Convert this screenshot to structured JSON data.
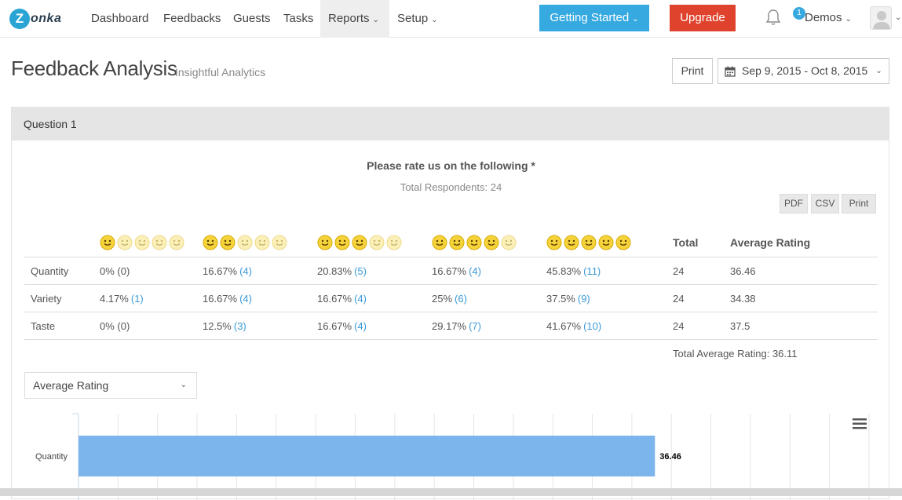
{
  "nav": {
    "logo_initial": "Z",
    "logo_rest": "onka",
    "items": [
      {
        "label": "Dashboard"
      },
      {
        "label": "Feedbacks"
      },
      {
        "label": "Guests"
      },
      {
        "label": "Tasks"
      },
      {
        "label": "Reports"
      },
      {
        "label": "Setup"
      }
    ],
    "getting_started": "Getting Started",
    "upgrade": "Upgrade",
    "notification_count": "1",
    "user": "Demos"
  },
  "page": {
    "title": "Feedback Analysis",
    "subtitle": "Insightful Analytics",
    "print": "Print",
    "date_range": "Sep 9, 2015 - Oct 8, 2015"
  },
  "panel": {
    "header": "Question 1",
    "question": "Please rate us on the following *",
    "respondents": "Total Respondents: 24",
    "export": [
      "PDF",
      "CSV",
      "Print"
    ]
  },
  "table": {
    "smiley_levels": [
      1,
      2,
      3,
      4,
      5
    ],
    "total_header": "Total",
    "avg_header": "Average Rating",
    "rows": [
      {
        "label": "Quantity",
        "cells": [
          {
            "pct": "0% (0)",
            "count": ""
          },
          {
            "pct": "16.67%",
            "count": "(4)"
          },
          {
            "pct": "20.83%",
            "count": "(5)"
          },
          {
            "pct": "16.67%",
            "count": "(4)"
          },
          {
            "pct": "45.83%",
            "count": "(11)"
          }
        ],
        "total": "24",
        "avg": "36.46"
      },
      {
        "label": "Variety",
        "cells": [
          {
            "pct": "4.17%",
            "count": "(1)"
          },
          {
            "pct": "16.67%",
            "count": "(4)"
          },
          {
            "pct": "16.67%",
            "count": "(4)"
          },
          {
            "pct": "25%",
            "count": "(6)"
          },
          {
            "pct": "37.5%",
            "count": "(9)"
          }
        ],
        "total": "24",
        "avg": "34.38"
      },
      {
        "label": "Taste",
        "cells": [
          {
            "pct": "0% (0)",
            "count": ""
          },
          {
            "pct": "12.5%",
            "count": "(3)"
          },
          {
            "pct": "16.67%",
            "count": "(4)"
          },
          {
            "pct": "29.17%",
            "count": "(7)"
          },
          {
            "pct": "41.67%",
            "count": "(10)"
          }
        ],
        "total": "24",
        "avg": "37.5"
      }
    ],
    "total_average": "Total Average Rating: 36.11"
  },
  "chart_select": {
    "value": "Average Rating"
  },
  "colors": {
    "accent": "#36a9e1",
    "upgrade": "#e0432d",
    "bar": "#7cb5ec",
    "smile": "#f5d33b"
  },
  "chart_data": {
    "type": "bar",
    "orientation": "horizontal",
    "categories": [
      "Quantity"
    ],
    "values": [
      36.46
    ],
    "data_labels": [
      "36.46"
    ],
    "xlim": [
      0,
      50
    ],
    "grid": true
  }
}
